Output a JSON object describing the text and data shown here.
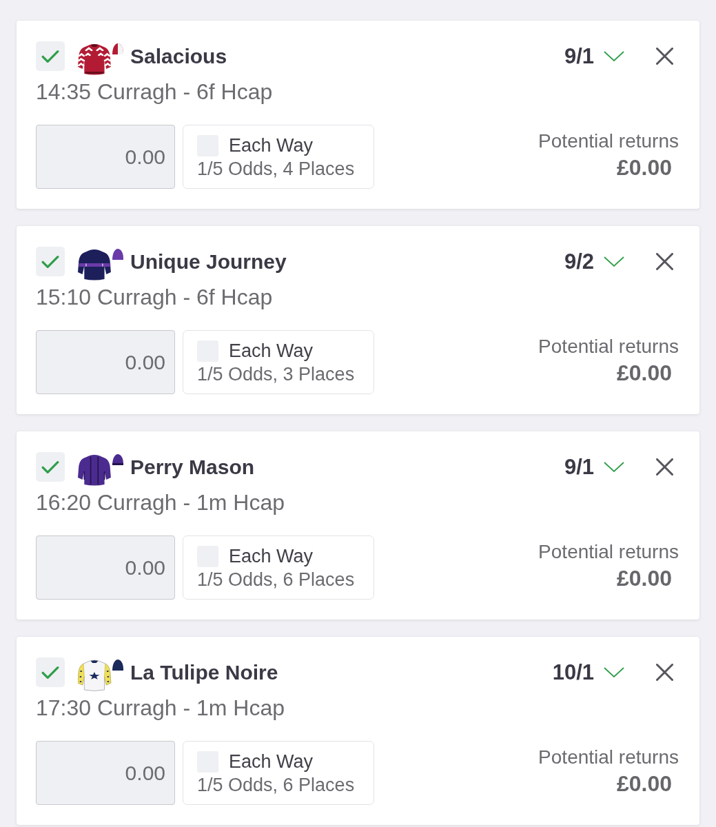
{
  "bets": [
    {
      "checked": true,
      "silk": {
        "kind": "chevrons"
      },
      "horse": "Salacious",
      "odds": "9/1",
      "race": "14:35 Curragh - 6f Hcap",
      "stake": {
        "placeholder": "0.00"
      },
      "each_way": {
        "label": "Each Way",
        "checked": false,
        "terms": "1/5 Odds, 4 Places"
      },
      "returns": {
        "label": "Potential returns",
        "amount": "£0.00"
      }
    },
    {
      "checked": true,
      "silk": {
        "kind": "hoop"
      },
      "horse": "Unique Journey",
      "odds": "9/2",
      "race": "15:10 Curragh - 6f Hcap",
      "stake": {
        "placeholder": "0.00"
      },
      "each_way": {
        "label": "Each Way",
        "checked": false,
        "terms": "1/5 Odds, 3 Places"
      },
      "returns": {
        "label": "Potential returns",
        "amount": "£0.00"
      }
    },
    {
      "checked": true,
      "silk": {
        "kind": "braces"
      },
      "horse": "Perry Mason",
      "odds": "9/1",
      "race": "16:20 Curragh - 1m Hcap",
      "stake": {
        "placeholder": "0.00"
      },
      "each_way": {
        "label": "Each Way",
        "checked": false,
        "terms": "1/5 Odds, 6 Places"
      },
      "returns": {
        "label": "Potential returns",
        "amount": "£0.00"
      }
    },
    {
      "checked": true,
      "silk": {
        "kind": "star"
      },
      "horse": "La Tulipe Noire",
      "odds": "10/1",
      "race": "17:30 Curragh - 1m Hcap",
      "stake": {
        "placeholder": "0.00"
      },
      "each_way": {
        "label": "Each Way",
        "checked": false,
        "terms": "1/5 Odds, 6 Places"
      },
      "returns": {
        "label": "Potential returns",
        "amount": "£0.00"
      }
    }
  ]
}
